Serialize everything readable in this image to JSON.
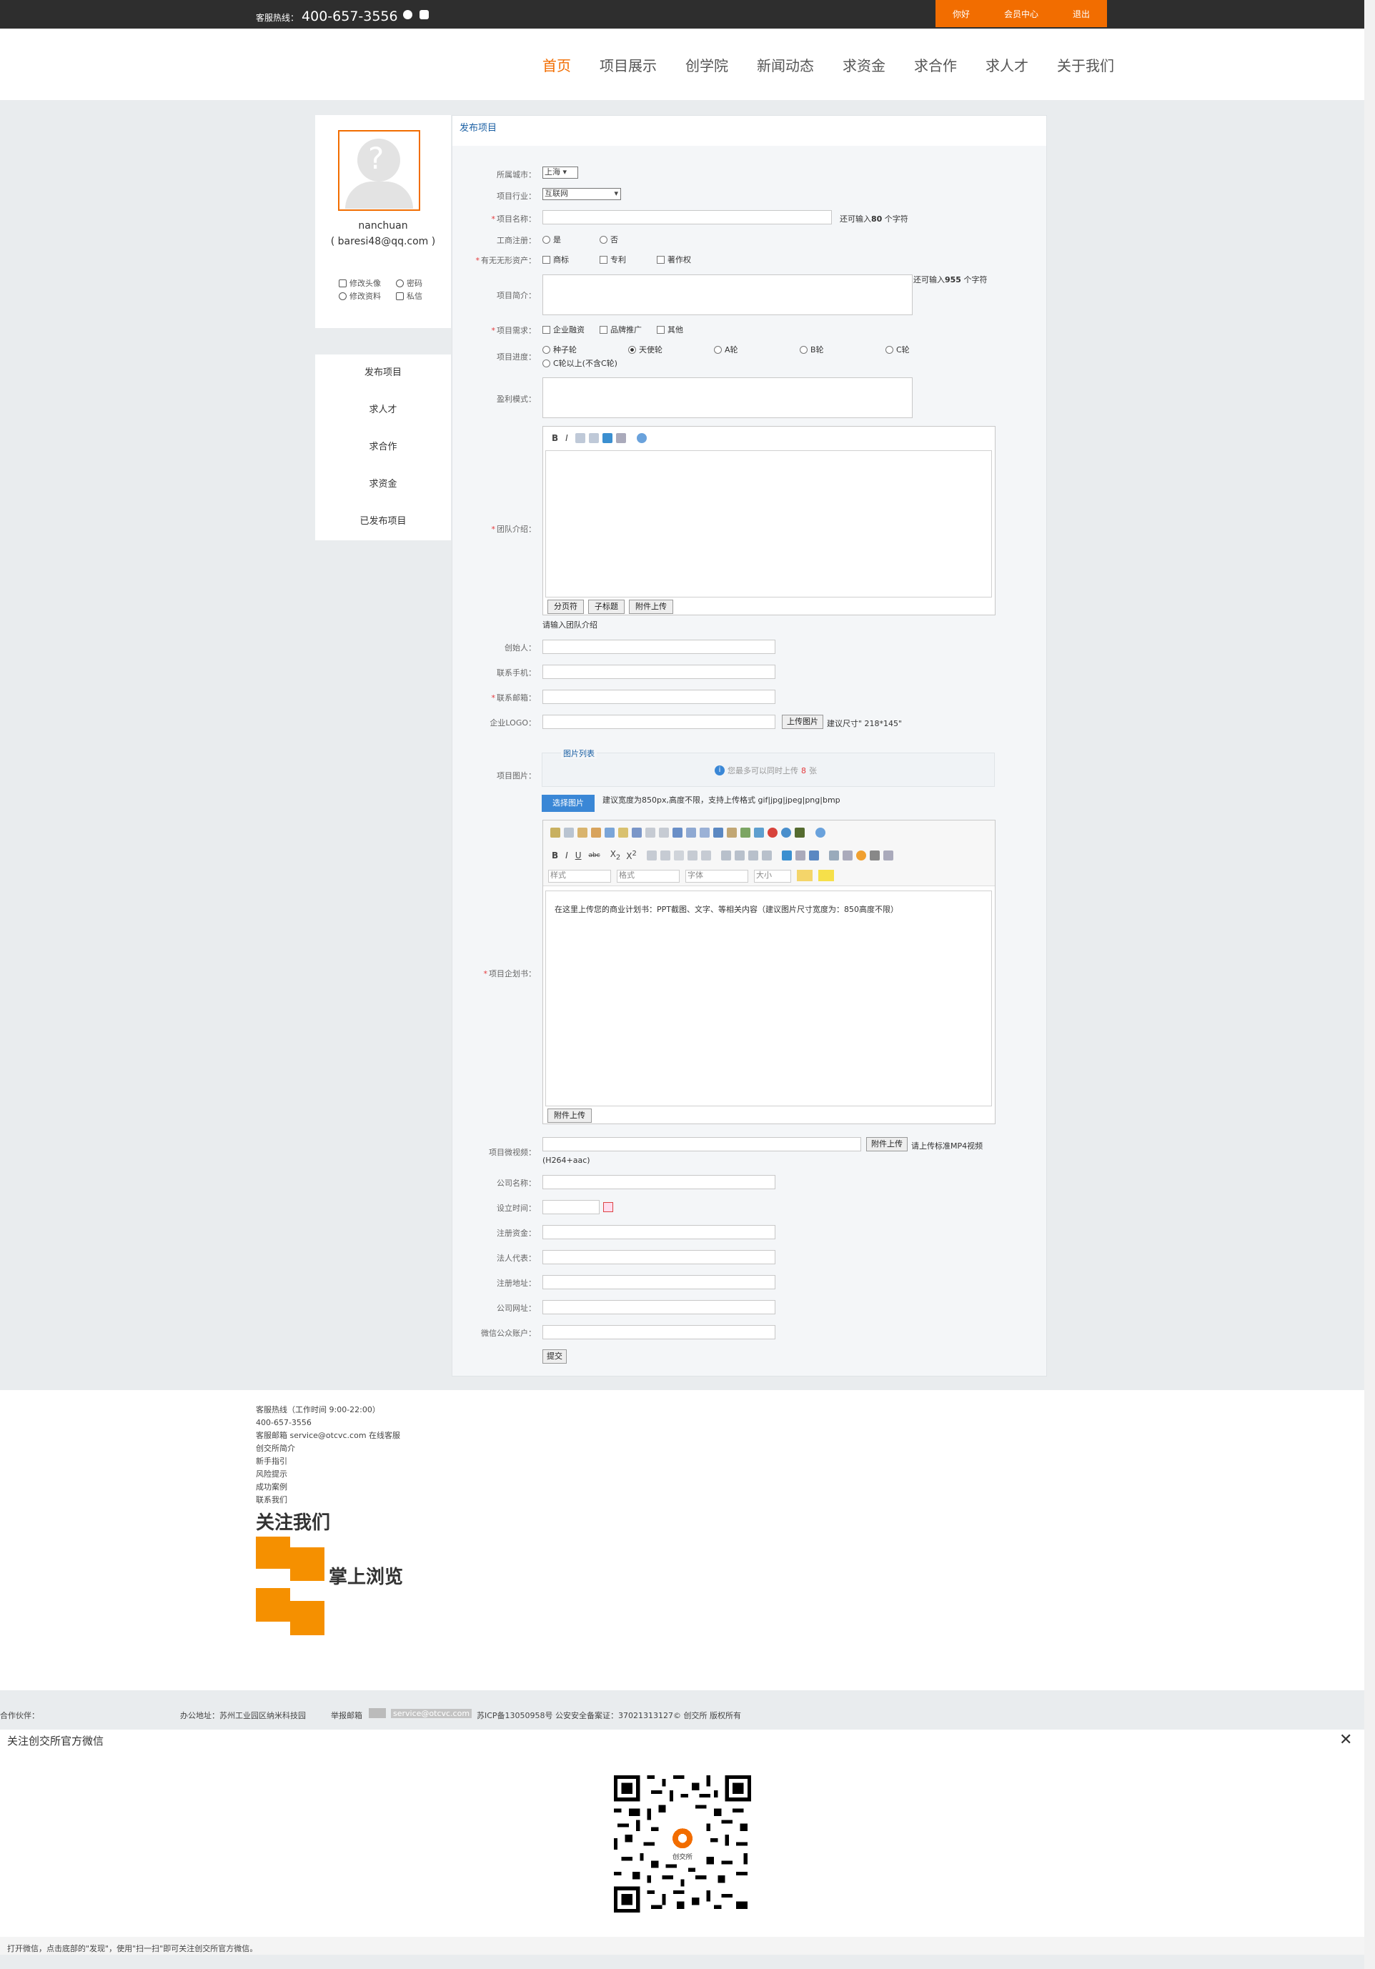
{
  "topbar": {
    "hotline_label": "客服热线：",
    "hotline_number": "400-657-3556",
    "icons": [
      "qq-icon",
      "wechat-icon"
    ],
    "links": [
      "你好",
      "会员中心",
      "退出"
    ]
  },
  "nav": {
    "items": [
      "首页",
      "项目展示",
      "创学院",
      "新闻动态",
      "求资金",
      "求合作",
      "求人才",
      "关于我们"
    ],
    "active": 0
  },
  "profile": {
    "username": "nanchuan",
    "email": "( baresi48@qq.com )",
    "links": {
      "avatar": "修改头像",
      "password": "密码",
      "profile": "修改资料",
      "message": "私信"
    }
  },
  "sidemenu": [
    "发布项目",
    "求人才",
    "求合作",
    "求资金",
    "已发布项目"
  ],
  "form": {
    "title": "发布项目",
    "city_label": "所属城市：",
    "city_value": "上海",
    "industry_label": "项目行业：",
    "industry_value": "互联网",
    "name_label": "项目名称：",
    "name_hint_prefix": "还可输入",
    "name_hint_num": "80",
    "name_hint_suffix": " 个字符",
    "reg_label": "工商注册：",
    "reg_yes": "是",
    "reg_no": "否",
    "asset_label": "有无无形资产：",
    "asset_opts": [
      "商标",
      "专利",
      "著作权"
    ],
    "intro_label": "项目简介：",
    "intro_hint_prefix": "还可输入",
    "intro_hint_num": "955",
    "intro_hint_suffix": " 个字符",
    "need_label": "项目需求：",
    "need_opts": [
      "企业融资",
      "品牌推广",
      "其他"
    ],
    "stage_label": "项目进度：",
    "stage_opts": [
      "种子轮",
      "天使轮",
      "A轮",
      "B轮",
      "C轮"
    ],
    "stage_opt_last": "C轮以上(不含C轮)",
    "profit_label": "盈利模式：",
    "team_label": "团队介绍：",
    "team_foot": [
      "分页符",
      "子标题",
      "附件上传"
    ],
    "team_hint": "请输入团队介绍",
    "founder_label": "创始人：",
    "phone_label": "联系手机：",
    "email_label": "联系邮箱：",
    "logo_label": "企业LOGO：",
    "logo_btn": "上传图片",
    "logo_hint": "建议尺寸\" 218*145\"",
    "img_label": "项目图片：",
    "img_panel_title": "图片列表",
    "img_limit_prefix": "您最多可以同时上传 ",
    "img_limit_num": "8",
    "img_limit_suffix": " 张",
    "img_btn": "选择图片",
    "img_hint": "建议宽度为850px,高度不限，支持上传格式 gif|jpg|jpeg|png|bmp",
    "plan_label": "项目企划书：",
    "plan_selects": [
      "样式",
      "格式",
      "字体",
      "大小"
    ],
    "plan_text": "在这里上传您的商业计划书：PPT截图、文字、等相关内容（建议图片尺寸宽度为：850高度不限）",
    "plan_foot": "附件上传",
    "video_label": "项目微视频：",
    "video_btn": "附件上传",
    "video_hint": "请上传标准MP4视频",
    "video_hint2": "(H264+aac)",
    "company_label": "公司名称：",
    "date_label": "设立时间：",
    "capital_label": "注册资金：",
    "legal_label": "法人代表：",
    "addr_label": "注册地址：",
    "site_label": "公司网址：",
    "wechat_label": "微信公众账户：",
    "submit": "提交"
  },
  "footer": {
    "hotline_title": "客服热线（工作时间 9:00-22:00）",
    "hotline_number": "400-657-3556",
    "email_line": "客服邮箱 service@otcvc.com 在线客服",
    "links": [
      "创交所简介",
      "新手指引",
      "风险提示",
      "成功案例",
      "联系我们"
    ],
    "follow": "关注我们",
    "mobile": "掌上浏览",
    "partners": "合作伙伴：",
    "address": "办公地址：苏州工业园区纳米科技园",
    "report": "举报邮箱",
    "report_email": "service@otcvc.com",
    "icp": "苏ICP备13050958号 公安安全备案证：37021313127© 创交所 版权所有"
  },
  "qr": {
    "title": "关注创交所官方微信",
    "logo_text": "创交所",
    "tip": "打开微信，点击底部的\"发现\"，使用\"扫一扫\"即可关注创交所官方微信。"
  },
  "colors": {
    "accent": "#f26d00",
    "topbar": "#2e2e2e",
    "link": "#1a5fa3",
    "button_blue": "#3a87d6"
  }
}
